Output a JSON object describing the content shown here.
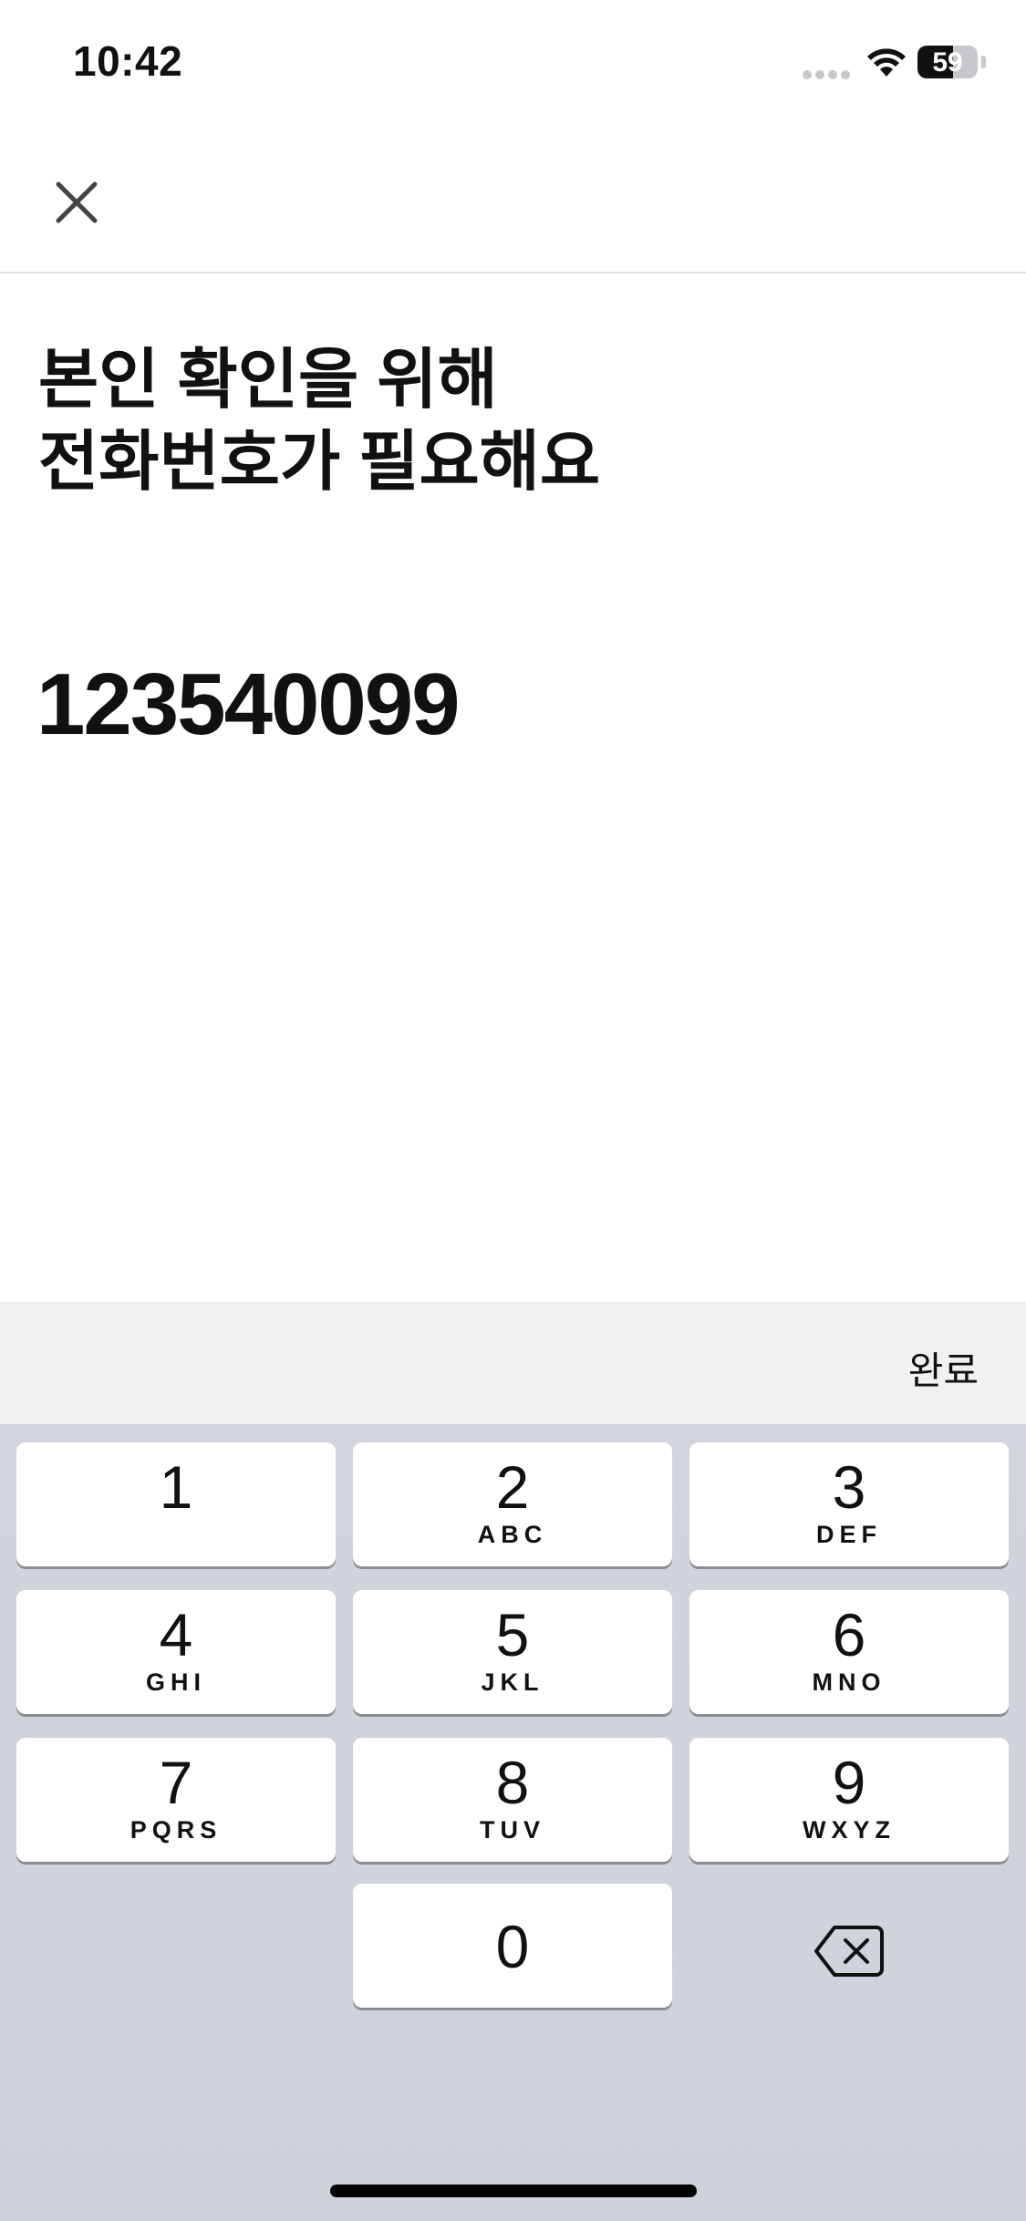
{
  "status_bar": {
    "time": "10:42",
    "battery_level": "59",
    "icons": [
      "signal-icon",
      "wifi-icon",
      "battery-icon"
    ]
  },
  "header": {
    "close_icon": "close-icon"
  },
  "title": {
    "line1": "본인 확인을 위해",
    "line2": "전화번호가 필요해요"
  },
  "phone_input": {
    "value": "123540099"
  },
  "accessory": {
    "done_label": "완료"
  },
  "keypad": {
    "keys": [
      {
        "digit": "1",
        "letters": ""
      },
      {
        "digit": "2",
        "letters": "ABC"
      },
      {
        "digit": "3",
        "letters": "DEF"
      },
      {
        "digit": "4",
        "letters": "GHI"
      },
      {
        "digit": "5",
        "letters": "JKL"
      },
      {
        "digit": "6",
        "letters": "MNO"
      },
      {
        "digit": "7",
        "letters": "PQRS"
      },
      {
        "digit": "8",
        "letters": "TUV"
      },
      {
        "digit": "9",
        "letters": "WXYZ"
      },
      {
        "digit": "0",
        "letters": ""
      }
    ],
    "backspace_icon": "backspace-icon"
  },
  "colors": {
    "keypad_background": "#D1D5DB",
    "accessory_background": "#F1F1F1",
    "key_background": "#FFFFFF",
    "text": "#111111"
  }
}
